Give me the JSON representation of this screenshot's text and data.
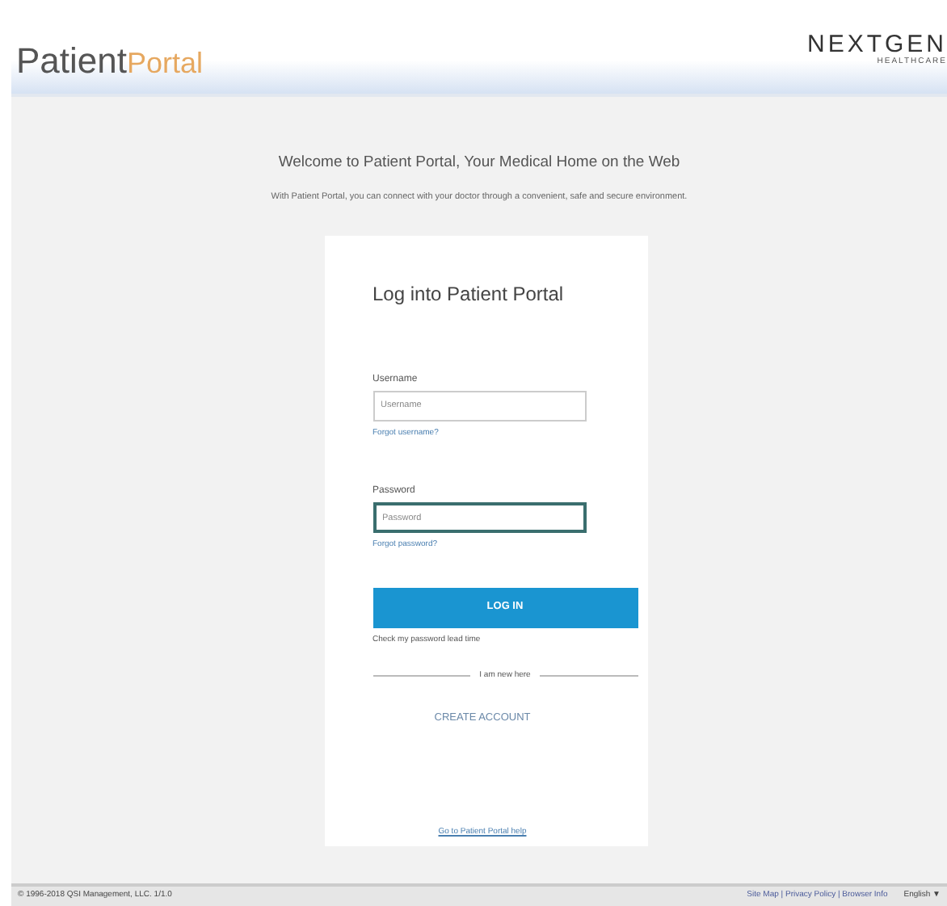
{
  "header": {
    "logo_first": "Patient",
    "logo_second": "Portal",
    "brand": "NEXTGEN",
    "brand_sub": "HEALTHCARE"
  },
  "welcome": {
    "title": "Welcome to Patient Portal, Your Medical Home on the Web",
    "text": "With Patient Portal, you can connect with your doctor through a convenient, safe and secure environment."
  },
  "login": {
    "title": "Log into Patient Portal",
    "fields": [
      {
        "label": "Username",
        "placeholder": "Username",
        "focused": false,
        "link": "Forgot username?"
      },
      {
        "label": "Password",
        "placeholder": "Password",
        "focused": true,
        "link": "Forgot password?"
      }
    ],
    "button": "LOG IN",
    "note": "Check my password lead time",
    "divider": "I am new here",
    "create": "CREATE ACCOUNT",
    "help": "Go to Patient Portal help"
  },
  "footer": {
    "copyright": "© 1996-2018 QSI Management, LLC. 1/1.0",
    "links": "Site Map | Privacy Policy | Browser Info",
    "language": "English ▼"
  }
}
